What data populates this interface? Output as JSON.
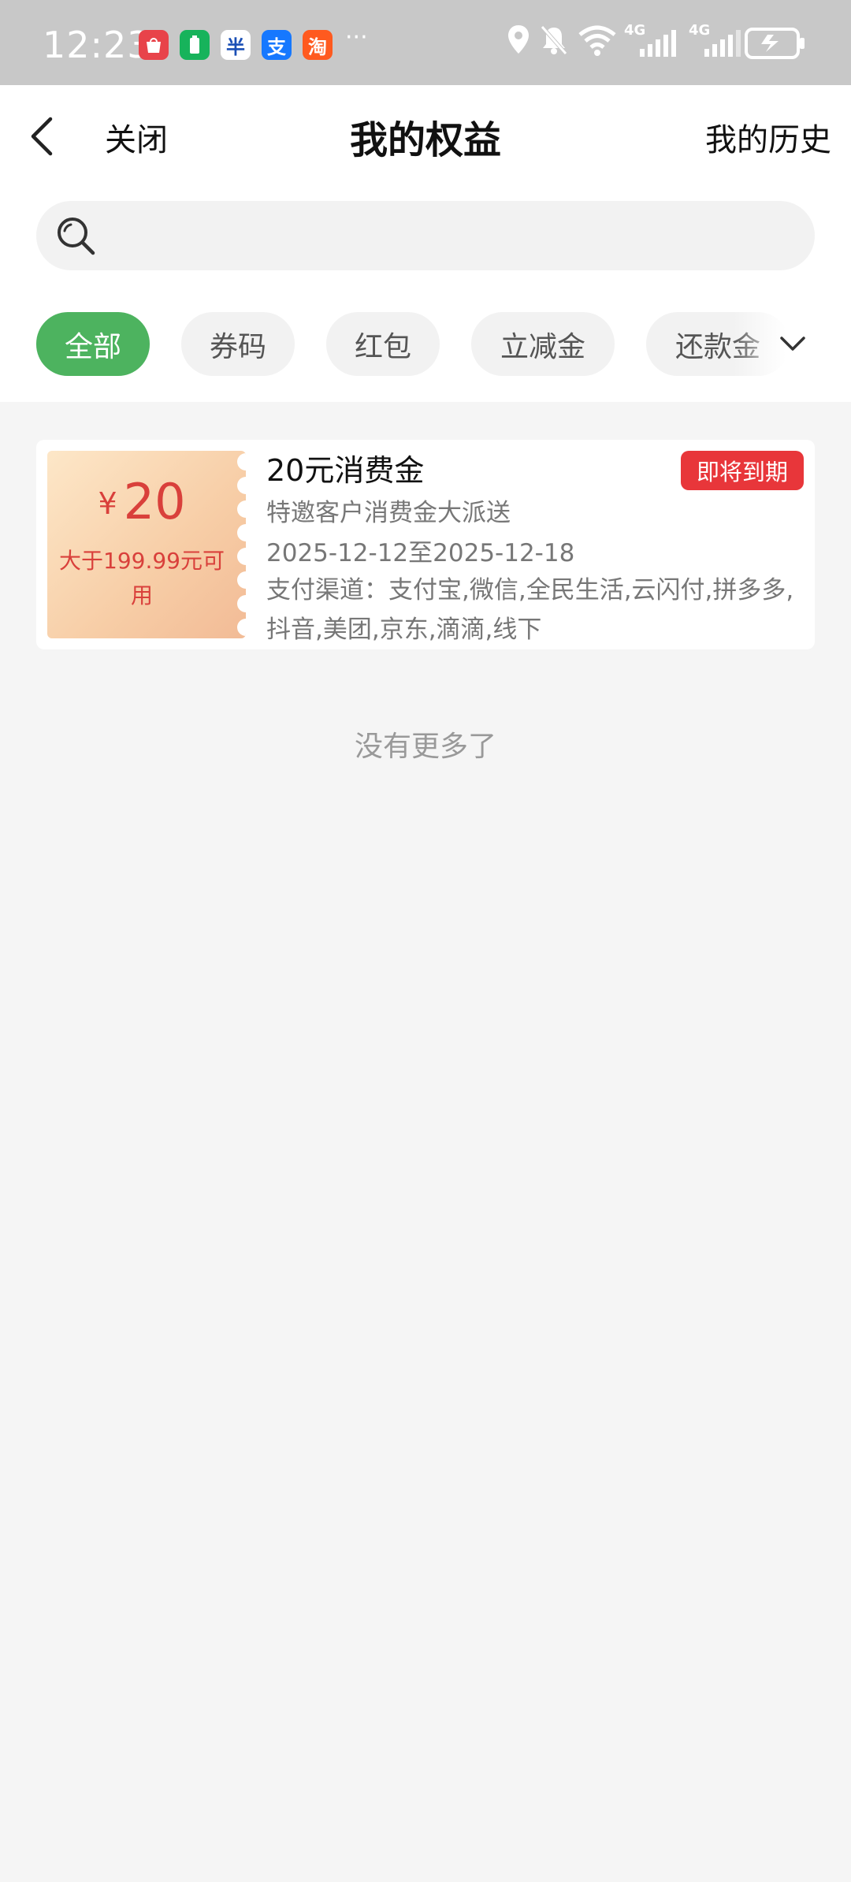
{
  "status_bar": {
    "time": "12:23",
    "apps": [
      {
        "name": "huawei-appgallery",
        "glyph": "",
        "color": "#e8434a"
      },
      {
        "name": "battery-app",
        "glyph": "▮",
        "color": "#17b35b"
      },
      {
        "name": "unionpay-app",
        "glyph": "半",
        "color": "#ffffff"
      },
      {
        "name": "alipay-app",
        "glyph": "支",
        "color": "#1678ff"
      },
      {
        "name": "taobao-app",
        "glyph": "淘",
        "color": "#ff5a1f"
      }
    ],
    "more": "···",
    "network_1": "4G",
    "network_2": "4G"
  },
  "header": {
    "back_icon": "chevron-left-icon",
    "close_label": "关闭",
    "title": "我的权益",
    "history_label": "我的历史"
  },
  "search": {
    "placeholder": "",
    "value": ""
  },
  "tabs": [
    {
      "label": "全部",
      "active": true
    },
    {
      "label": "券码",
      "active": false
    },
    {
      "label": "红包",
      "active": false
    },
    {
      "label": "立减金",
      "active": false
    },
    {
      "label": "还款金",
      "active": false
    }
  ],
  "coupons": [
    {
      "currency": "¥",
      "amount": "20",
      "condition": "大于199.99元可用",
      "title": "20元消费金",
      "subtitle": "特邀客户消费金大派送",
      "date_range": "2025-12-12至2025-12-18",
      "channels": "支付渠道：支付宝,微信,全民生活,云闪付,拼多多,抖音,美团,京东,滴滴,线下",
      "badge": "即将到期"
    }
  ],
  "footer_text": "没有更多了",
  "colors": {
    "accent": "#4db35f",
    "badge": "#e8363a",
    "amount": "#d9403b"
  }
}
